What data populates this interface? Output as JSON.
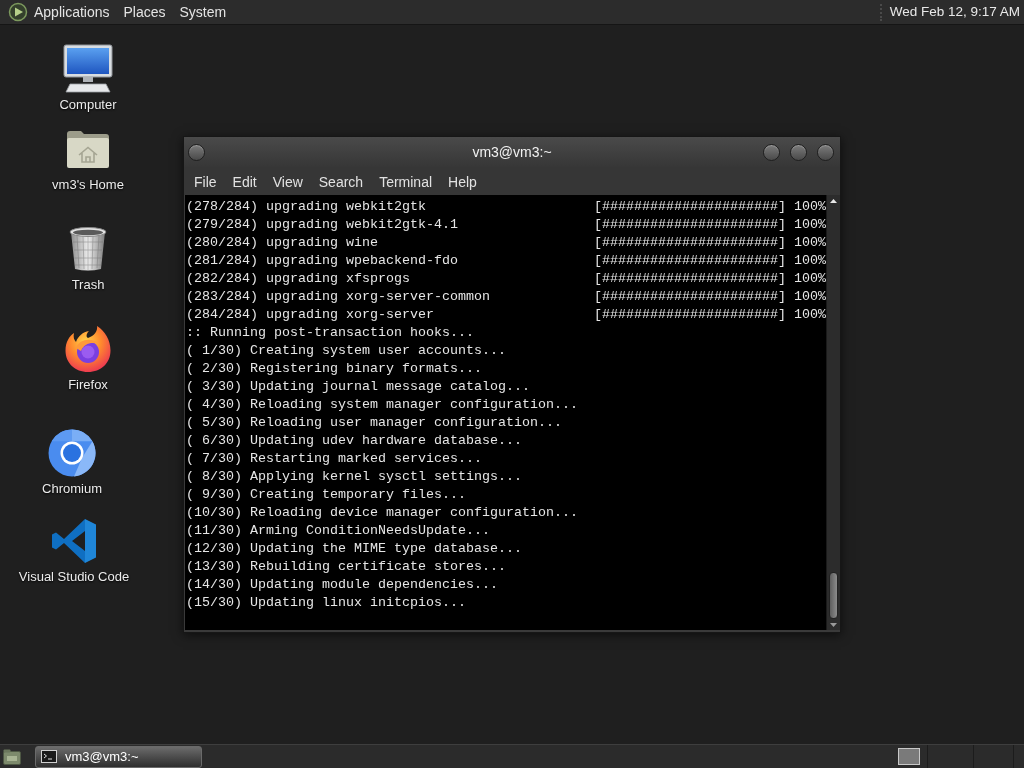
{
  "top_panel": {
    "menus": [
      "Applications",
      "Places",
      "System"
    ],
    "clock": "Wed Feb 12, 9:17 AM"
  },
  "desktop_icons": [
    {
      "kind": "computer",
      "label": "Computer"
    },
    {
      "kind": "home",
      "label": "vm3's Home"
    },
    {
      "kind": "trash",
      "label": "Trash"
    },
    {
      "kind": "firefox",
      "label": "Firefox"
    },
    {
      "kind": "chromium",
      "label": "Chromium"
    },
    {
      "kind": "vscode",
      "label": "Visual Studio Code"
    }
  ],
  "terminal": {
    "title": "vm3@vm3:~",
    "menu": [
      "File",
      "Edit",
      "View",
      "Search",
      "Terminal",
      "Help"
    ],
    "lines": [
      {
        "text": "(278/284) upgrading webkit2gtk",
        "progress": "[######################] 100%"
      },
      {
        "text": "(279/284) upgrading webkit2gtk-4.1",
        "progress": "[######################] 100%"
      },
      {
        "text": "(280/284) upgrading wine",
        "progress": "[######################] 100%"
      },
      {
        "text": "(281/284) upgrading wpebackend-fdo",
        "progress": "[######################] 100%"
      },
      {
        "text": "(282/284) upgrading xfsprogs",
        "progress": "[######################] 100%"
      },
      {
        "text": "(283/284) upgrading xorg-server-common",
        "progress": "[######################] 100%"
      },
      {
        "text": "(284/284) upgrading xorg-server",
        "progress": "[######################] 100%"
      },
      {
        "text": ":: Running post-transaction hooks..."
      },
      {
        "text": "( 1/30) Creating system user accounts..."
      },
      {
        "text": "( 2/30) Registering binary formats..."
      },
      {
        "text": "( 3/30) Updating journal message catalog..."
      },
      {
        "text": "( 4/30) Reloading system manager configuration..."
      },
      {
        "text": "( 5/30) Reloading user manager configuration..."
      },
      {
        "text": "( 6/30) Updating udev hardware database..."
      },
      {
        "text": "( 7/30) Restarting marked services..."
      },
      {
        "text": "( 8/30) Applying kernel sysctl settings..."
      },
      {
        "text": "( 9/30) Creating temporary files..."
      },
      {
        "text": "(10/30) Reloading device manager configuration..."
      },
      {
        "text": "(11/30) Arming ConditionNeedsUpdate..."
      },
      {
        "text": "(12/30) Updating the MIME type database..."
      },
      {
        "text": "(13/30) Rebuilding certificate stores..."
      },
      {
        "text": "(14/30) Updating module dependencies..."
      },
      {
        "text": "(15/30) Updating linux initcpios..."
      }
    ]
  },
  "taskbar": {
    "windows": [
      {
        "title": "vm3@vm3:~",
        "selected": true
      }
    ]
  }
}
